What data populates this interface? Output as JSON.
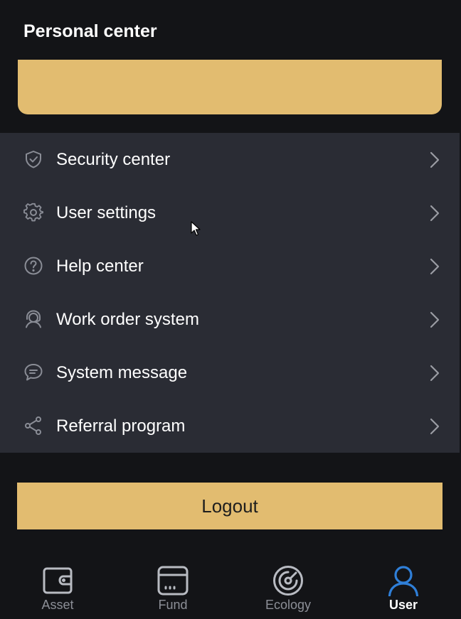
{
  "header": {
    "title": "Personal center"
  },
  "menu": {
    "items": [
      {
        "label": "Security center",
        "icon": "shield-check-icon"
      },
      {
        "label": "User settings",
        "icon": "gear-icon"
      },
      {
        "label": "Help center",
        "icon": "question-circle-icon"
      },
      {
        "label": "Work order system",
        "icon": "customer-service-icon"
      },
      {
        "label": "System message",
        "icon": "chat-bubble-icon"
      },
      {
        "label": "Referral program",
        "icon": "share-icon"
      }
    ]
  },
  "logout_label": "Logout",
  "tabbar": {
    "tabs": [
      {
        "label": "Asset",
        "icon": "wallet-icon",
        "active": false
      },
      {
        "label": "Fund",
        "icon": "fund-icon",
        "active": false
      },
      {
        "label": "Ecology",
        "icon": "radar-icon",
        "active": false
      },
      {
        "label": "User",
        "icon": "user-icon",
        "active": true
      }
    ]
  },
  "colors": {
    "background": "#131417",
    "menu_background": "#2a2c34",
    "accent": "#e2bc70",
    "active_tab": "#2f7fd8",
    "inactive_tab": "#8c8f97"
  }
}
